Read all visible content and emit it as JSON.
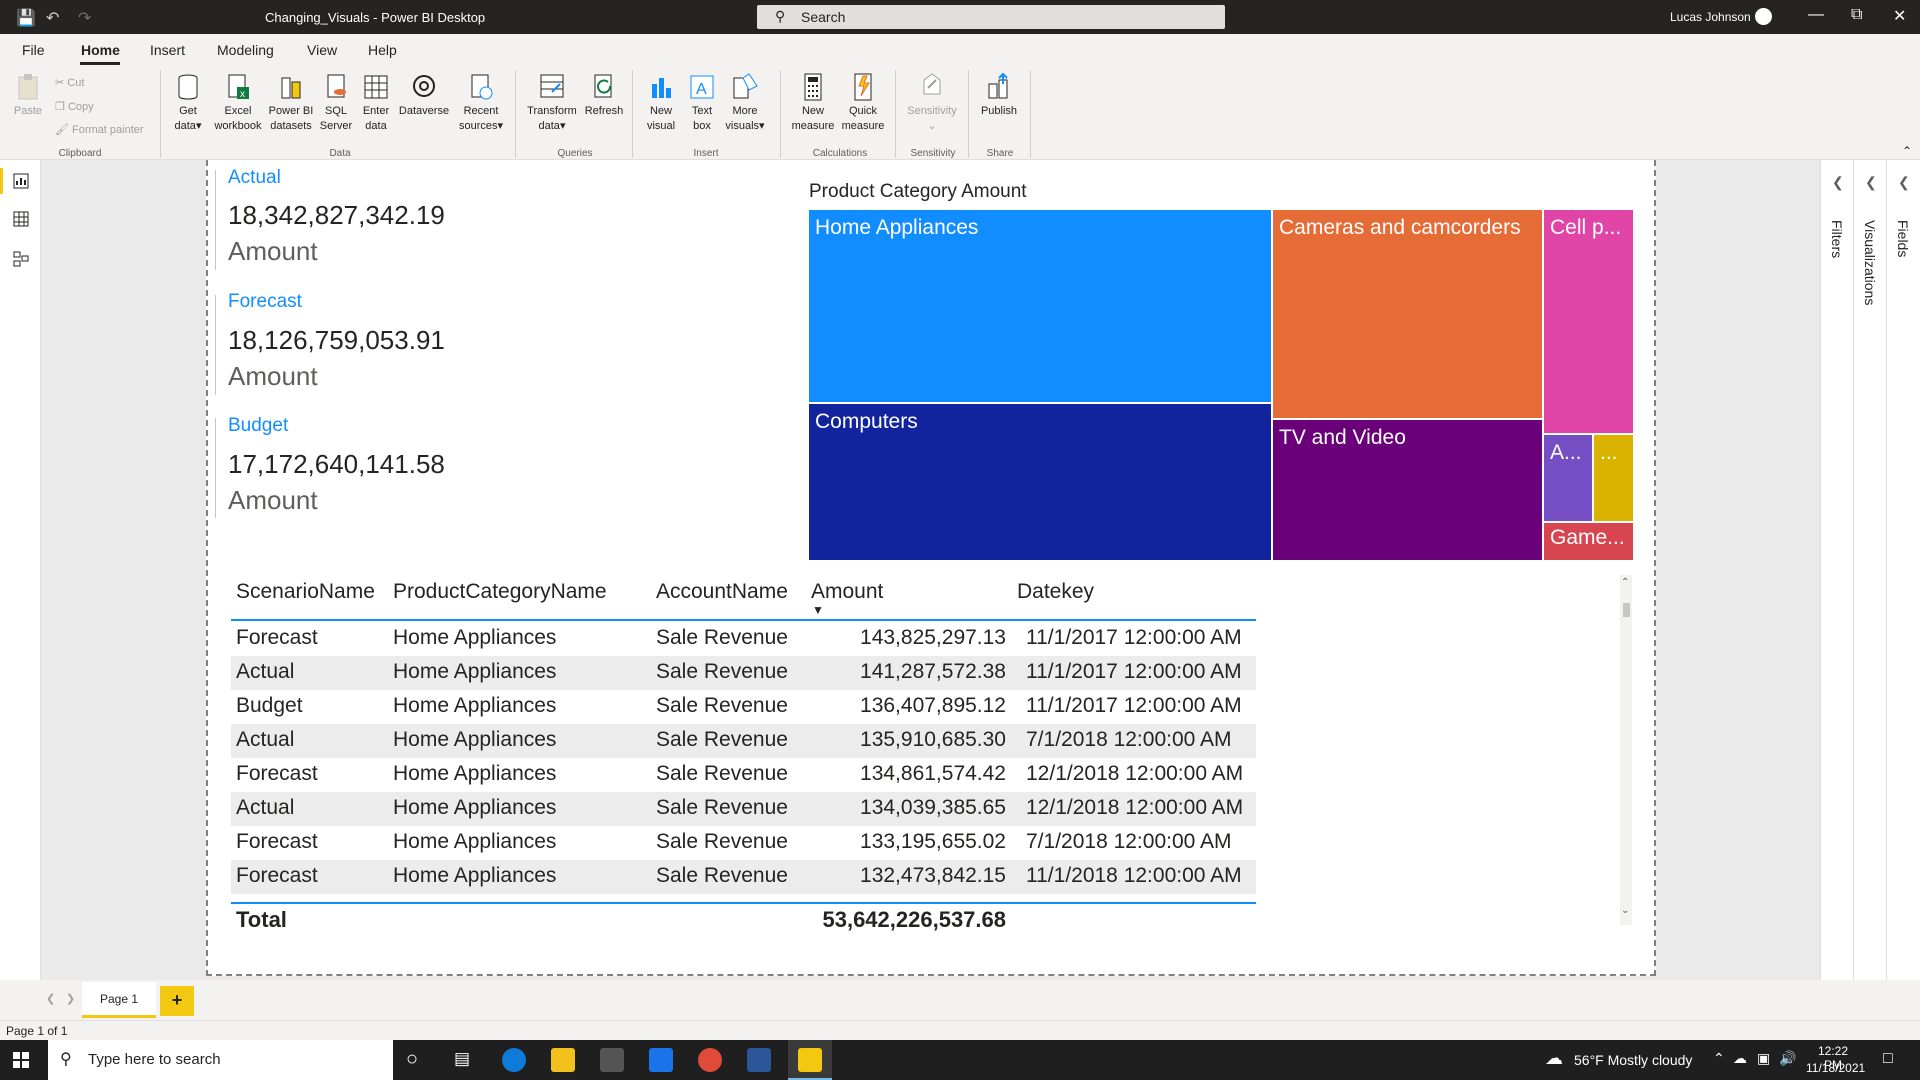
{
  "window": {
    "title": "Changing_Visuals - Power BI Desktop",
    "search_placeholder": "Search",
    "user": "Lucas Johnson"
  },
  "menu": [
    "File",
    "Home",
    "Insert",
    "Modeling",
    "View",
    "Help"
  ],
  "ribbon": {
    "clipboard": {
      "paste": "Paste",
      "cut": "Cut",
      "copy": "Copy",
      "format_painter": "Format painter",
      "group": "Clipboard"
    },
    "data": {
      "get_data_1": "Get",
      "get_data_2": "data",
      "excel_1": "Excel",
      "excel_2": "workbook",
      "pbi_1": "Power BI",
      "pbi_2": "datasets",
      "sql_1": "SQL",
      "sql_2": "Server",
      "enter_1": "Enter",
      "enter_2": "data",
      "dataverse": "Dataverse",
      "recent_1": "Recent",
      "recent_2": "sources",
      "group": "Data"
    },
    "queries": {
      "transform_1": "Transform",
      "transform_2": "data",
      "refresh": "Refresh",
      "group": "Queries"
    },
    "insert": {
      "newvisual_1": "New",
      "newvisual_2": "visual",
      "textbox_1": "Text",
      "textbox_2": "box",
      "more_1": "More",
      "more_2": "visuals",
      "group": "Insert"
    },
    "calculations": {
      "newmeasure_1": "New",
      "newmeasure_2": "measure",
      "quick_1": "Quick",
      "quick_2": "measure",
      "group": "Calculations"
    },
    "sensitivity": {
      "label": "Sensitivity",
      "group": "Sensitivity"
    },
    "share": {
      "publish": "Publish",
      "group": "Share"
    }
  },
  "cards": [
    {
      "label": "Actual",
      "value": "18,342,827,342.19",
      "sub": "Amount"
    },
    {
      "label": "Forecast",
      "value": "18,126,759,053.91",
      "sub": "Amount"
    },
    {
      "label": "Budget",
      "value": "17,172,640,141.58",
      "sub": "Amount"
    }
  ],
  "treemap": {
    "title": "Product Category Amount",
    "tiles": [
      {
        "label": "Home Appliances",
        "color": "#118dff"
      },
      {
        "label": "Computers",
        "color": "#12239e"
      },
      {
        "label": "Cameras and camcorders",
        "color": "#e66c37"
      },
      {
        "label": "TV and Video",
        "color": "#6b007b"
      },
      {
        "label": "Cell p...",
        "color": "#e044a7"
      },
      {
        "label": "A...",
        "color": "#744ec2"
      },
      {
        "label": "...",
        "color": "#d9b300"
      },
      {
        "label": "Game...",
        "color": "#d64550"
      }
    ]
  },
  "table": {
    "headers": [
      "ScenarioName",
      "ProductCategoryName",
      "AccountName",
      "Amount",
      "Datekey"
    ],
    "rows": [
      [
        "Forecast",
        "Home Appliances",
        "Sale Revenue",
        "143,825,297.13",
        "11/1/2017 12:00:00 AM"
      ],
      [
        "Actual",
        "Home Appliances",
        "Sale Revenue",
        "141,287,572.38",
        "11/1/2017 12:00:00 AM"
      ],
      [
        "Budget",
        "Home Appliances",
        "Sale Revenue",
        "136,407,895.12",
        "11/1/2017 12:00:00 AM"
      ],
      [
        "Actual",
        "Home Appliances",
        "Sale Revenue",
        "135,910,685.30",
        "7/1/2018 12:00:00 AM"
      ],
      [
        "Forecast",
        "Home Appliances",
        "Sale Revenue",
        "134,861,574.42",
        "12/1/2018 12:00:00 AM"
      ],
      [
        "Actual",
        "Home Appliances",
        "Sale Revenue",
        "134,039,385.65",
        "12/1/2018 12:00:00 AM"
      ],
      [
        "Forecast",
        "Home Appliances",
        "Sale Revenue",
        "133,195,655.02",
        "7/1/2018 12:00:00 AM"
      ],
      [
        "Forecast",
        "Home Appliances",
        "Sale Revenue",
        "132,473,842.15",
        "11/1/2018 12:00:00 AM"
      ]
    ],
    "total_label": "Total",
    "total_value": "53,642,226,537.68"
  },
  "panes": {
    "filters": "Filters",
    "visualizations": "Visualizations",
    "fields": "Fields"
  },
  "pages": {
    "tab": "Page 1",
    "add": "+",
    "status": "Page 1 of 1"
  },
  "taskbar": {
    "search_placeholder": "Type here to search",
    "weather": "56°F  Mostly cloudy",
    "time": "12:22 PM",
    "date": "11/18/2021"
  }
}
